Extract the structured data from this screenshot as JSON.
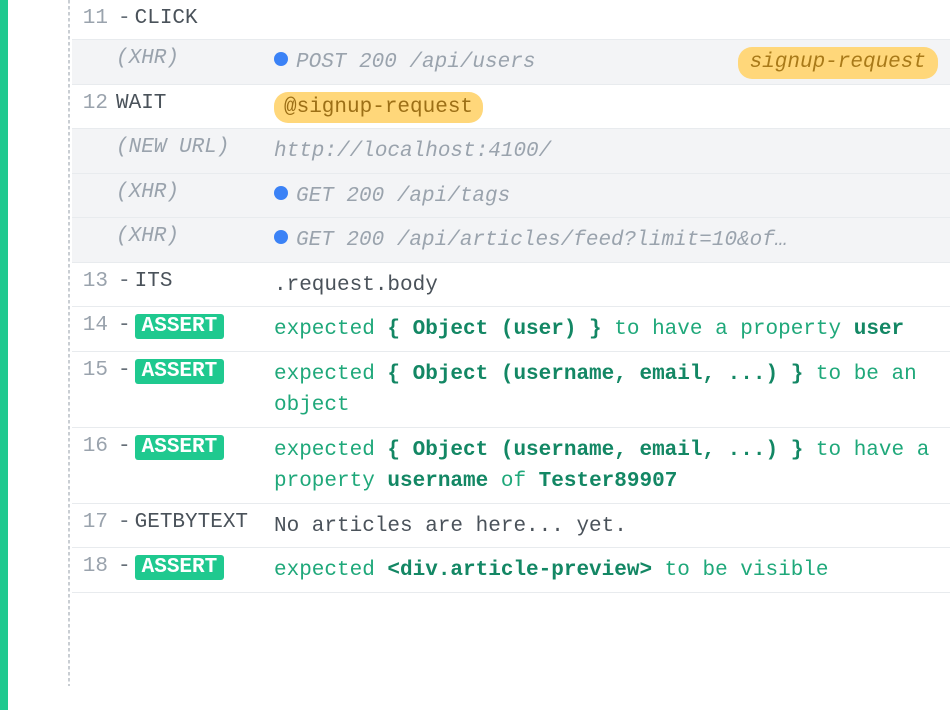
{
  "rows": [
    {
      "lineno": "11",
      "dash": "-",
      "cmd": "CLICK",
      "cmdStyle": "plain",
      "alt": false,
      "msg": {
        "type": "empty"
      }
    },
    {
      "lineno": "",
      "cmd": "(XHR)",
      "cmdStyle": "italic",
      "alt": true,
      "msg": {
        "type": "xhr",
        "method": "POST",
        "status": "200",
        "path": "/api/users",
        "badge": "signup-request"
      }
    },
    {
      "lineno": "12",
      "cmd": "WAIT",
      "cmdStyle": "plain",
      "alt": false,
      "msg": {
        "type": "alias",
        "text": "@signup-request"
      }
    },
    {
      "lineno": "",
      "cmd": "(NEW URL)",
      "cmdStyle": "italic",
      "alt": true,
      "msg": {
        "type": "url",
        "text": "http://localhost:4100/"
      }
    },
    {
      "lineno": "",
      "cmd": "(XHR)",
      "cmdStyle": "italic",
      "alt": true,
      "msg": {
        "type": "xhr",
        "method": "GET",
        "status": "200",
        "path": "/api/tags"
      }
    },
    {
      "lineno": "",
      "cmd": "(XHR)",
      "cmdStyle": "italic",
      "alt": true,
      "msg": {
        "type": "xhr",
        "method": "GET",
        "status": "200",
        "path": "/api/articles/feed?limit=10&of…"
      }
    },
    {
      "lineno": "13",
      "dash": "-",
      "cmd": "ITS",
      "cmdStyle": "plain",
      "alt": false,
      "msg": {
        "type": "plain",
        "text": ".request.body"
      }
    },
    {
      "lineno": "14",
      "dash": "-",
      "cmd": "ASSERT",
      "cmdStyle": "assert",
      "alt": false,
      "msg": {
        "type": "assert",
        "parts": [
          {
            "t": "sel",
            "v": "expected "
          },
          {
            "t": "bold",
            "v": "{ Object (user) }"
          },
          {
            "t": "sel",
            "v": " to have a property "
          },
          {
            "t": "bold",
            "v": "user"
          }
        ]
      }
    },
    {
      "lineno": "15",
      "dash": "-",
      "cmd": "ASSERT",
      "cmdStyle": "assert",
      "alt": false,
      "msg": {
        "type": "assert",
        "parts": [
          {
            "t": "sel",
            "v": "expected "
          },
          {
            "t": "bold",
            "v": "{ Object (username, email, ...) }"
          },
          {
            "t": "sel",
            "v": " to be an object"
          }
        ]
      }
    },
    {
      "lineno": "16",
      "dash": "-",
      "cmd": "ASSERT",
      "cmdStyle": "assert",
      "alt": false,
      "msg": {
        "type": "assert",
        "parts": [
          {
            "t": "sel",
            "v": "expected "
          },
          {
            "t": "bold",
            "v": "{ Object (username, email, ...) }"
          },
          {
            "t": "sel",
            "v": " to have a property "
          },
          {
            "t": "bold",
            "v": "username"
          },
          {
            "t": "sel",
            "v": " of "
          },
          {
            "t": "bold",
            "v": "Tester89907"
          }
        ]
      }
    },
    {
      "lineno": "17",
      "dash": "-",
      "cmd": "GETBYTEXT",
      "cmdStyle": "plain",
      "alt": false,
      "msg": {
        "type": "plain",
        "text": "No articles are here... yet."
      }
    },
    {
      "lineno": "18",
      "dash": "-",
      "cmd": "ASSERT",
      "cmdStyle": "assert",
      "alt": false,
      "msg": {
        "type": "assert",
        "parts": [
          {
            "t": "sel",
            "v": "expected "
          },
          {
            "t": "bold",
            "v": "<div.article-preview>"
          },
          {
            "t": "sel",
            "v": " to be visible"
          }
        ]
      }
    }
  ]
}
